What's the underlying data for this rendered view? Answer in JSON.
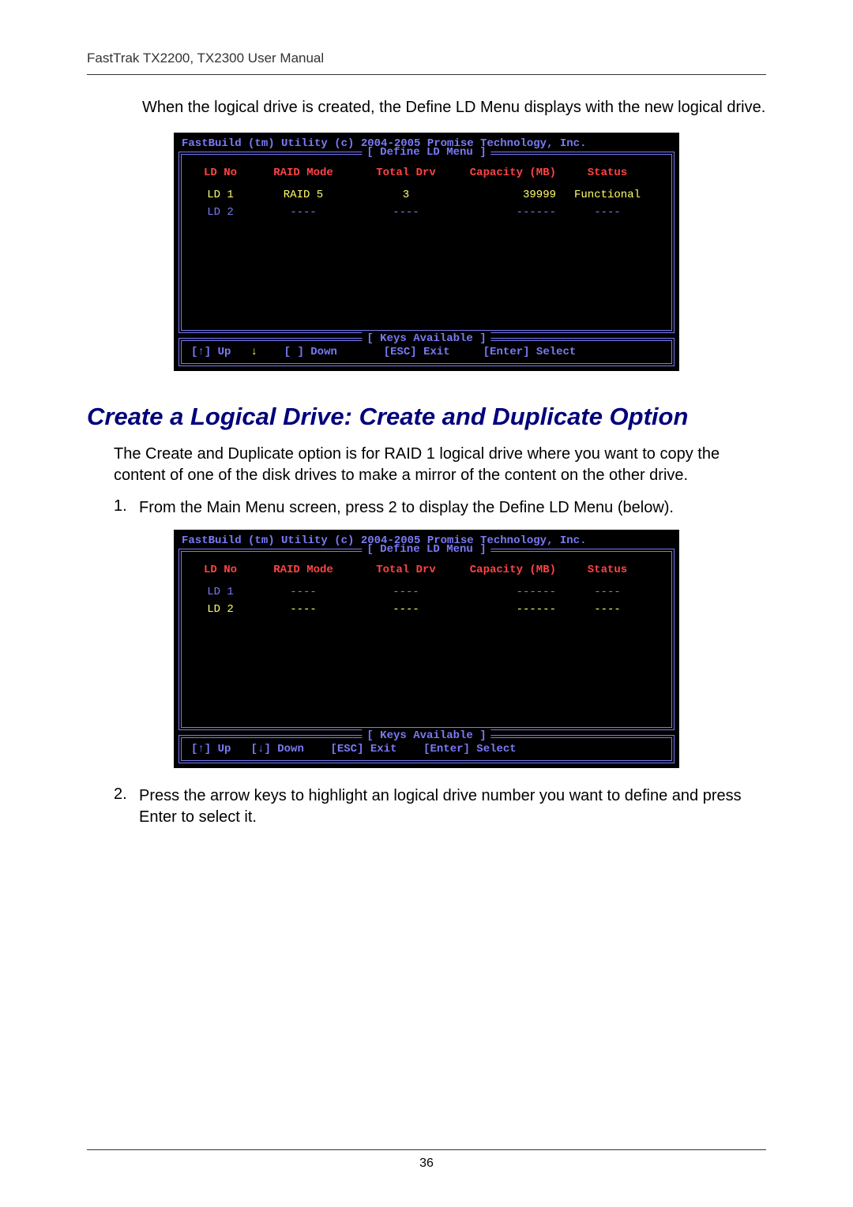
{
  "doc": {
    "header": "FastTrak TX2200, TX2300 User Manual",
    "page_number": "36",
    "intro_text": "When the logical drive is created, the Define LD Menu displays with the new logical drive.",
    "section_title": "Create a Logical Drive: Create and Duplicate Option",
    "section_body": "The Create and Duplicate option is for RAID 1 logical drive where you want to copy the content of one of the disk drives to make a mirror of the content on the other drive.",
    "steps": [
      {
        "num": "1.",
        "text": "From the Main Menu screen, press 2 to display the Define LD Menu (below)."
      },
      {
        "num": "2.",
        "text": "Press the arrow keys to highlight an logical drive number you want to define and press Enter to select it."
      }
    ]
  },
  "bios_common": {
    "topline": "FastBuild (tm) Utility (c) 2004-2005 Promise Technology, Inc.",
    "frame_title": "[ Define LD Menu ]",
    "keys_title": "[ Keys Available ]",
    "columns": {
      "ld": "LD No",
      "raid": "RAID Mode",
      "drv": "Total Drv",
      "cap": "Capacity (MB)",
      "stat": "Status"
    }
  },
  "bios1": {
    "rows": [
      {
        "ld": "LD 1",
        "raid": "RAID 5",
        "drv": "3",
        "cap": "39999",
        "stat": "Functional",
        "sel": true
      },
      {
        "ld": "LD 2",
        "raid": "----",
        "drv": "----",
        "cap": "------",
        "stat": "----",
        "sel": false
      }
    ],
    "keys_left": "[↑] Up",
    "keys_down_arrow": "↓",
    "keys_downlbl": "[ ] Down",
    "keys_esc": "[ESC] Exit",
    "keys_enter": "[Enter] Select"
  },
  "bios2": {
    "rows": [
      {
        "ld": "LD 1",
        "raid": "----",
        "drv": "----",
        "cap": "------",
        "stat": "----",
        "sel": false
      },
      {
        "ld": "LD 2",
        "raid": "----",
        "drv": "----",
        "cap": "------",
        "stat": "----",
        "sel": true
      }
    ],
    "keys_up": "[↑] Up",
    "keys_down": "[↓] Down",
    "keys_esc": "[ESC] Exit",
    "keys_enter": "[Enter] Select"
  }
}
